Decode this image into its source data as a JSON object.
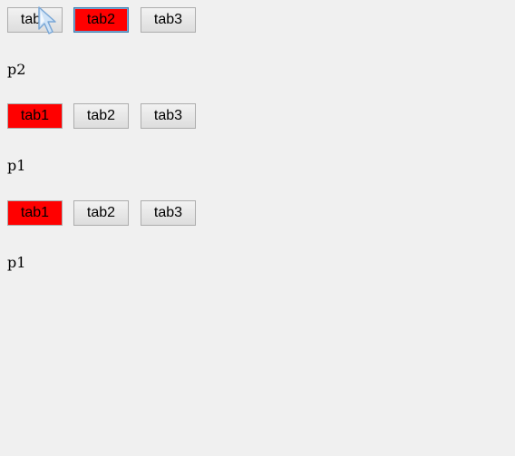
{
  "groups": [
    {
      "tabs": [
        {
          "label": "tab1"
        },
        {
          "label": "tab2"
        },
        {
          "label": "tab3"
        }
      ],
      "active_tab": "tab2",
      "panel_text": "p2"
    },
    {
      "tabs": [
        {
          "label": "tab1"
        },
        {
          "label": "tab2"
        },
        {
          "label": "tab3"
        }
      ],
      "active_tab": "tab1",
      "panel_text": "p1"
    },
    {
      "tabs": [
        {
          "label": "tab1"
        },
        {
          "label": "tab2"
        },
        {
          "label": "tab3"
        }
      ],
      "active_tab": "tab1",
      "panel_text": "p1"
    }
  ],
  "colors": {
    "active_tab": "#ff0000",
    "background": "#f0f0f0"
  },
  "cursor_icon": "pointer-arrow-icon"
}
